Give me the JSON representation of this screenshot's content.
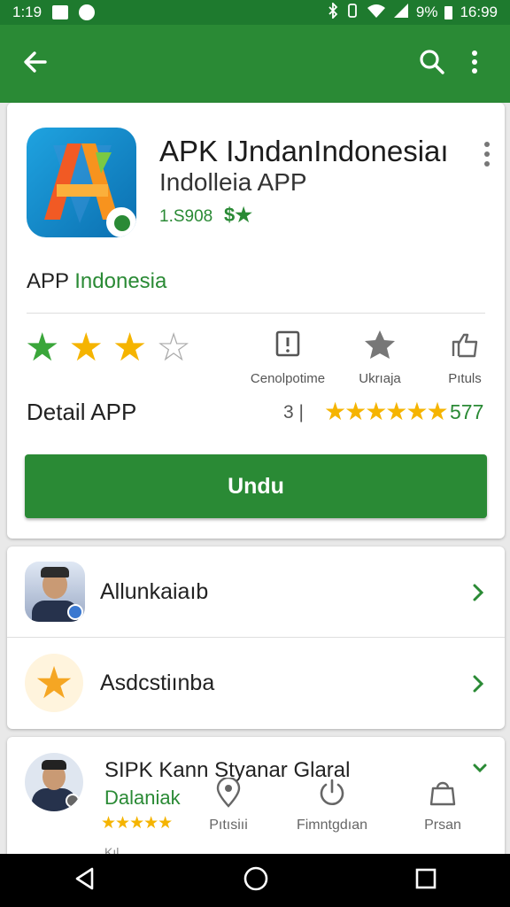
{
  "status_bar": {
    "time_left": "1:19",
    "battery_percent": "9%",
    "time_right": "16:99"
  },
  "toolbar": {
    "back_icon": "arrow-left-icon",
    "search_icon": "search-icon",
    "more_icon": "more-vertical-icon"
  },
  "app": {
    "title": "APK IJndanIndonesiaı",
    "subtitle": "Indolleia APP",
    "size": "1.S908",
    "category_part1": "APP",
    "category_part2": "Indonesia"
  },
  "rating": {
    "stars_filled": 3,
    "stars_total": 4
  },
  "actions": [
    {
      "label": "Cenolpotime",
      "icon": "flag-icon"
    },
    {
      "label": "Ukrıaja",
      "icon": "star-icon"
    },
    {
      "label": "Pıtuls",
      "icon": "share-icon"
    }
  ],
  "detail": {
    "title": "Detail APP",
    "count": "3",
    "stars": "★★★★★★",
    "score": "577"
  },
  "download_button": "Undu",
  "list": [
    {
      "name": "Allunkaiaıb",
      "icon": "person-avatar-icon"
    },
    {
      "name": "Asdcstiınba",
      "icon": "star-badge-icon"
    }
  ],
  "bottom_card": {
    "title": "SIPK Kann Styanar Glaral",
    "subtitle": "Dalaniak",
    "stars": "★★★★★",
    "tail": "Kıl ... ."
  },
  "bottom_tabs": [
    {
      "label": "Pıtısiıi",
      "icon": "location-pin-icon"
    },
    {
      "label": "Fimntgdıan",
      "icon": "power-icon"
    },
    {
      "label": "Prsan",
      "icon": "bag-icon"
    }
  ],
  "colors": {
    "primary": "#2a8a35",
    "status_bar": "#1e7a2e",
    "star_yellow": "#f5b400",
    "star_green": "#3aa63a"
  }
}
